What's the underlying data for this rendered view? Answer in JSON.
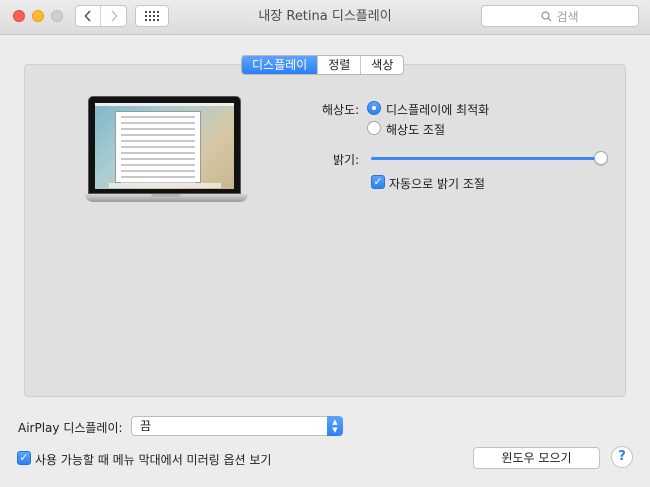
{
  "window": {
    "title": "내장 Retina 디스플레이"
  },
  "toolbar": {
    "search_placeholder": "검색"
  },
  "tabs": [
    {
      "label": "디스플레이",
      "active": true
    },
    {
      "label": "정렬",
      "active": false
    },
    {
      "label": "색상",
      "active": false
    }
  ],
  "resolution": {
    "label": "해상도:",
    "options": [
      {
        "label": "디스플레이에 최적화",
        "selected": true
      },
      {
        "label": "해상도 조절",
        "selected": false
      }
    ]
  },
  "brightness": {
    "label": "밝기:",
    "value": 1.0,
    "auto_label": "자동으로 밝기 조절",
    "auto_checked": true
  },
  "airplay": {
    "label": "AirPlay 디스플레이:",
    "value": "끔"
  },
  "mirroring": {
    "label": "사용 가능할 때 메뉴 막대에서 미러링 옵션 보기",
    "checked": true
  },
  "buttons": {
    "gather_windows": "윈도우 모으기",
    "help": "?"
  },
  "colors": {
    "accent": "#2d7ff6",
    "close": "#fc5f57",
    "minimize": "#fdbc2e"
  }
}
